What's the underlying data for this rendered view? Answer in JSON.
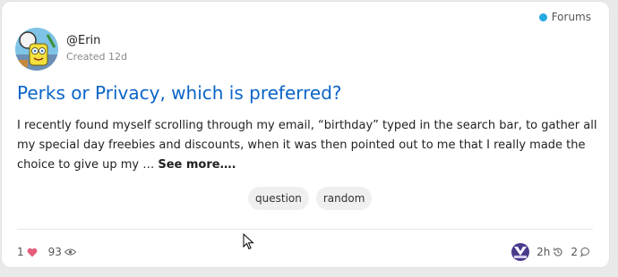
{
  "post": {
    "category": "Forums",
    "author": "@Erin",
    "created": "Created 12d",
    "title": "Perks or Privacy, which is preferred?",
    "excerpt": "I recently found myself scrolling through my email, “birthday” typed in the search bar, to gather all my special day freebies and discounts, when it was then pointed out to me that I really made the choice to give up my … ",
    "see_more": "See more….",
    "tags": [
      "question",
      "random"
    ],
    "likes": "1",
    "views": "93",
    "last_activity": "2h",
    "replies": "2"
  },
  "colors": {
    "category_dot": "#25aae1",
    "title": "#0a64c8",
    "heart": "#e45d7b"
  },
  "icons": [
    "heart-icon",
    "eye-icon",
    "history-icon",
    "comment-icon",
    "cursor-icon"
  ]
}
